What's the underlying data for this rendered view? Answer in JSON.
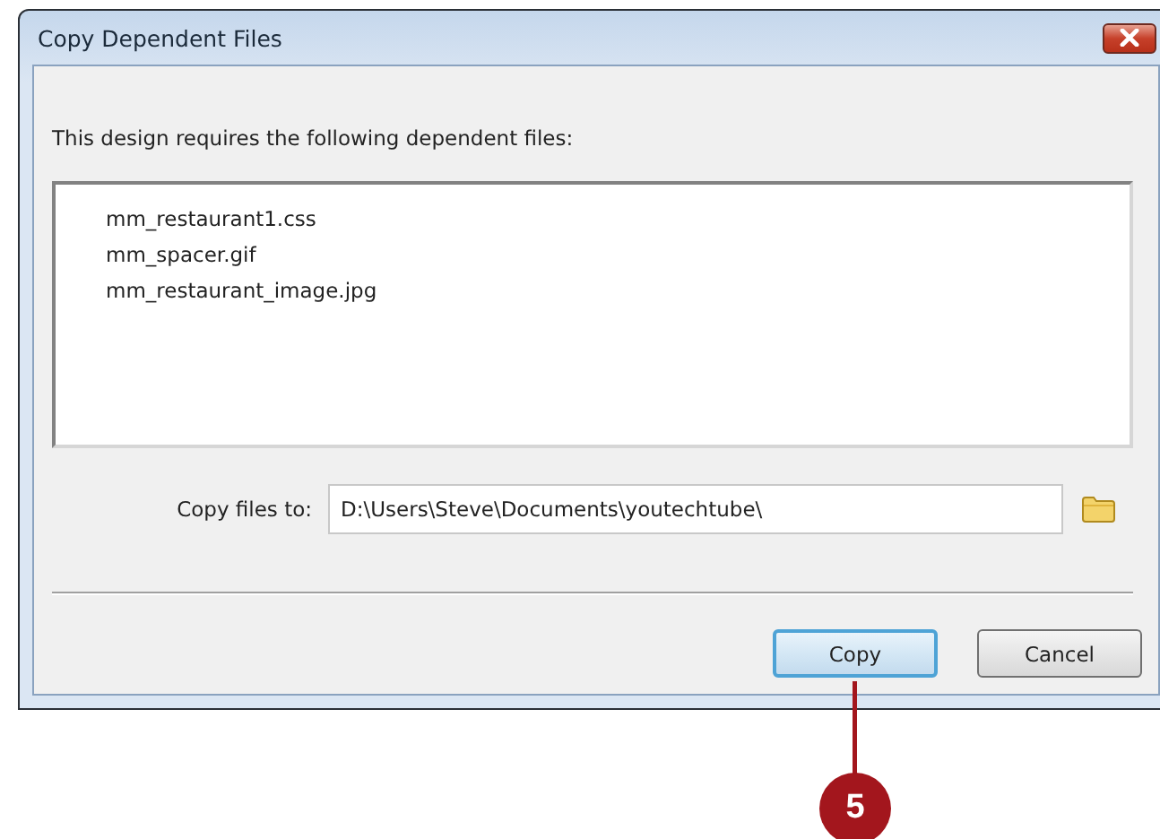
{
  "window": {
    "title": "Copy Dependent Files"
  },
  "message": "This design requires the following dependent files:",
  "files": [
    "mm_restaurant1.css",
    "mm_spacer.gif",
    "mm_restaurant_image.jpg"
  ],
  "destination": {
    "label": "Copy files to:",
    "value": "D:\\Users\\Steve\\Documents\\youtechtube\\"
  },
  "buttons": [
    {
      "label": "Copy",
      "focused": true
    },
    {
      "label": "Cancel",
      "focused": false
    }
  ],
  "callout": {
    "label": "5"
  }
}
